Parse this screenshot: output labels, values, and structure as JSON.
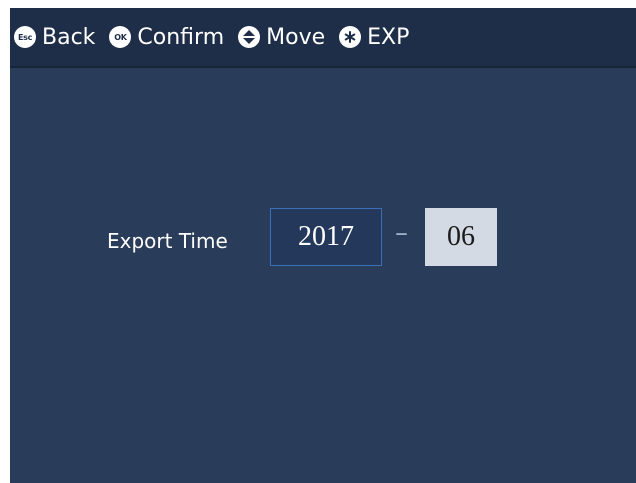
{
  "toolbar": {
    "back": {
      "key": "Esc",
      "label": "Back"
    },
    "confirm": {
      "key": "OK",
      "label": "Confirm"
    },
    "move": {
      "label": "Move"
    },
    "exp": {
      "label": "EXP"
    }
  },
  "form": {
    "label": "Export Time",
    "year": "2017",
    "separator": "–",
    "month": "06"
  },
  "colors": {
    "background": "#293c59",
    "toolbar": "#1f2e48",
    "year_border": "#3b6fb6",
    "month_selected": "#d3dae3"
  }
}
